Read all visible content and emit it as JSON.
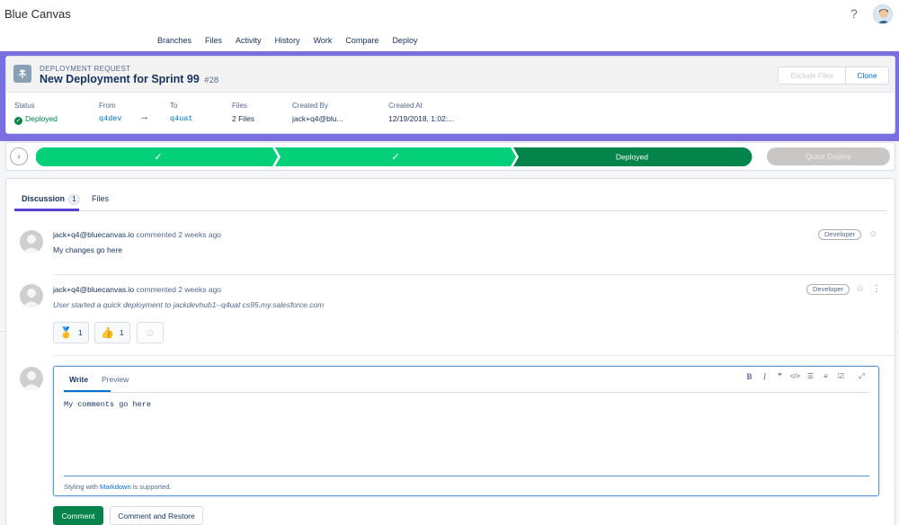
{
  "app": {
    "title": "Blue Canvas",
    "help": "?"
  },
  "nav": [
    "Branches",
    "Files",
    "Activity",
    "History",
    "Work",
    "Compare",
    "Deploy"
  ],
  "header": {
    "label": "DEPLOYMENT REQUEST",
    "title": "New Deployment for Sprint 99",
    "number": "#28",
    "exclude_label": "Exclude Files",
    "clone_label": "Clone",
    "meta": {
      "status_key": "Status",
      "status_value": "Deployed",
      "from_key": "From",
      "from_value": "q4dev",
      "to_key": "To",
      "to_value": "q4uat",
      "files_key": "Files",
      "files_value": "2 Files",
      "created_by_key": "Created By",
      "created_by_value": "jack+q4@blu...",
      "created_at_key": "Created At",
      "created_at_value": "12/19/2018, 1:02:..."
    },
    "arrow": "→"
  },
  "progress": {
    "toggle": "›",
    "steps": [
      {
        "label": "✓",
        "state": "done"
      },
      {
        "label": "✓",
        "state": "done"
      },
      {
        "label": "Deployed",
        "state": "current"
      }
    ],
    "quick_deploy_label": "Quick Deploy",
    "colors": {
      "done": "#04d07a",
      "current": "#04844b",
      "disabled": "#c9c7c5"
    }
  },
  "tabs": {
    "discussion_label": "Discussion",
    "discussion_count": "1",
    "files_label": "Files"
  },
  "comments": [
    {
      "author": "jack+q4@bluecanvas.io",
      "when": "commented 2 weeks ago",
      "body": "My changes go here",
      "role": "Developer"
    },
    {
      "author": "jack+q4@bluecanvas.io",
      "when": "commented 2 weeks ago",
      "body": "User started a quick deployment to jackdevhub1--q4uat cs95.my.salesforce.com",
      "role": "Developer",
      "reactions": [
        {
          "icon": "medal-icon",
          "glyph": "🥇",
          "count": "1"
        },
        {
          "icon": "thumbs-up-icon",
          "glyph": "👍",
          "count": "1"
        }
      ],
      "add_reaction_glyph": "☺",
      "more": "⋮"
    }
  ],
  "editor": {
    "write_label": "Write",
    "preview_label": "Preview",
    "tools": [
      "B",
      "I",
      "❞",
      "</>",
      "☰",
      "≡",
      "☑",
      "⤢"
    ],
    "text": "My comments go here",
    "note_prefix": "Styling with",
    "note_link": "Markdown",
    "note_suffix": "is supported."
  },
  "actions": {
    "comment_label": "Comment",
    "restore_label": "Comment and Restore"
  }
}
